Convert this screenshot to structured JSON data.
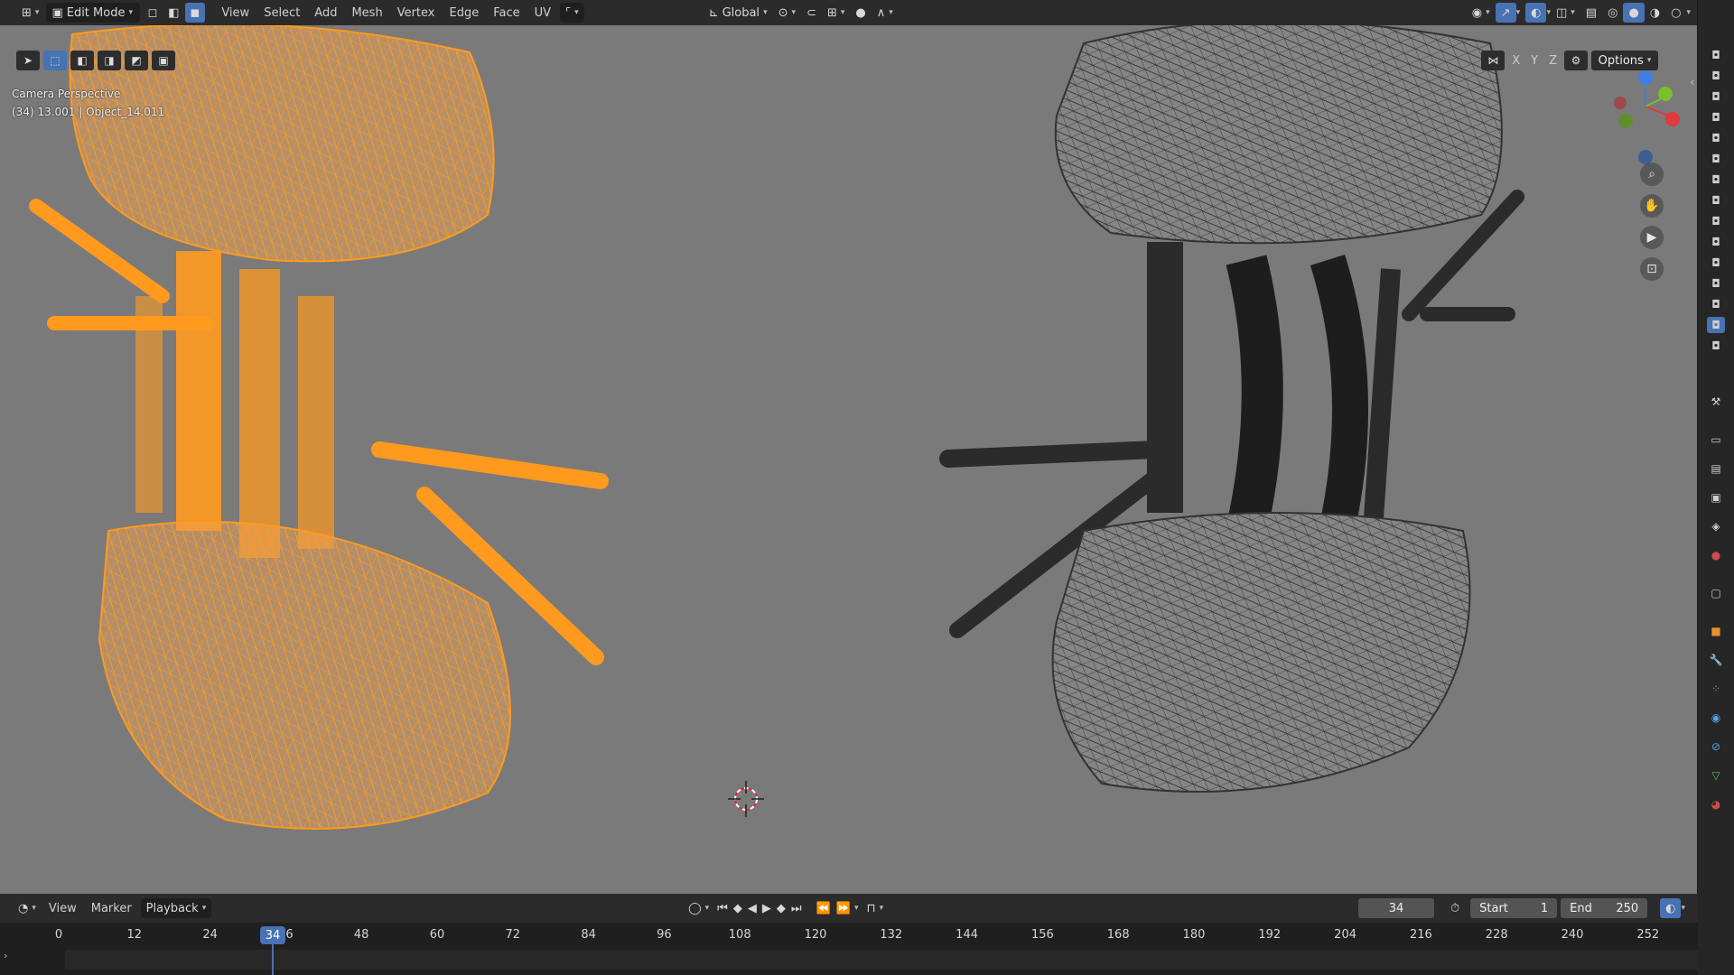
{
  "header": {
    "mode": "Edit Mode",
    "menus": [
      "View",
      "Select",
      "Add",
      "Mesh",
      "Vertex",
      "Edge",
      "Face",
      "UV"
    ],
    "orientation": "Global",
    "options_label": "Options",
    "axes": [
      "X",
      "Y",
      "Z"
    ]
  },
  "viewport": {
    "view_name": "Camera Perspective",
    "object_info": "(34) 13.001 | Object_14.011",
    "gizmo_axes": [
      "Z",
      "Y",
      "X"
    ]
  },
  "timeline": {
    "menus": [
      "View",
      "Marker",
      "Playback"
    ],
    "current_frame": "34",
    "start_label": "Start",
    "start_value": "1",
    "end_label": "End",
    "end_value": "250",
    "ticks": [
      "0",
      "12",
      "24",
      "36",
      "48",
      "60",
      "72",
      "84",
      "96",
      "108",
      "120",
      "132",
      "144",
      "156",
      "168",
      "180",
      "192",
      "204",
      "216",
      "228",
      "240",
      "252"
    ],
    "playhead_label": "34"
  },
  "colors": {
    "accent": "#4772b3",
    "selected_wire": "#ff9a1f",
    "viewport_bg": "#7a7a7a"
  },
  "icons": [
    "editor-type-icon",
    "select-box-icon",
    "vertex-mode-icon",
    "edge-mode-icon",
    "face-mode-icon",
    "transform-pivot-icon",
    "snap-icon",
    "proportional-icon",
    "overlay-icon",
    "gizmo-icon",
    "xray-icon",
    "shading-solid-icon",
    "zoom-icon",
    "hand-pan-icon",
    "camera-view-icon",
    "lock-icon",
    "play-icon",
    "keyframe-icon"
  ]
}
